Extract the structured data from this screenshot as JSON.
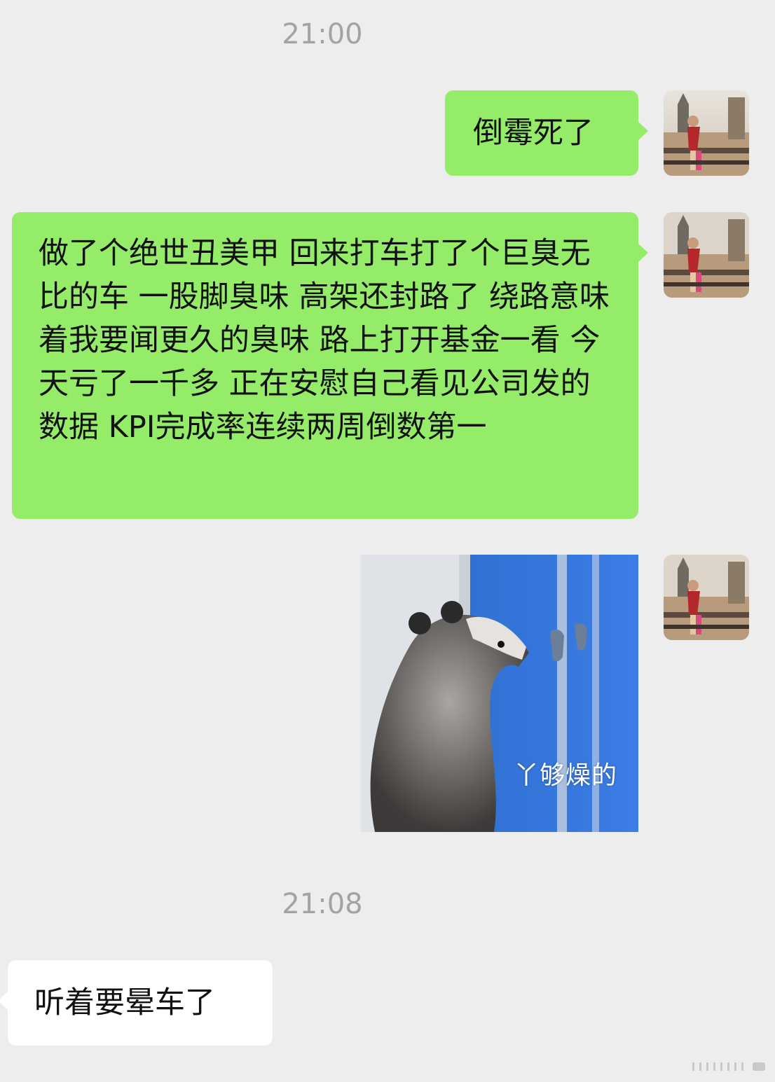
{
  "chat": {
    "timestamps": [
      "21:00",
      "21:08"
    ],
    "messages": [
      {
        "side": "sent",
        "type": "text",
        "text": "倒霉死了"
      },
      {
        "side": "sent",
        "type": "text",
        "text": "做了个绝世丑美甲 回来打车打了个巨臭无比的车 一股脚臭味 高架还封路了 绕路意味着我要闻更久的臭味 路上打开基金一看 今天亏了一千多 正在安慰自己看见公司发的数据 KPI完成率连续两周倒数第一"
      },
      {
        "side": "sent",
        "type": "sticker",
        "caption": "丫够燥的",
        "subject": "opossum-at-window"
      },
      {
        "side": "received",
        "type": "text",
        "text": "听着要晕车了"
      }
    ]
  },
  "colors": {
    "background": "#ededed",
    "sent_bubble": "#95ec69",
    "received_bubble": "#ffffff",
    "timestamp": "#a3a3a3"
  }
}
